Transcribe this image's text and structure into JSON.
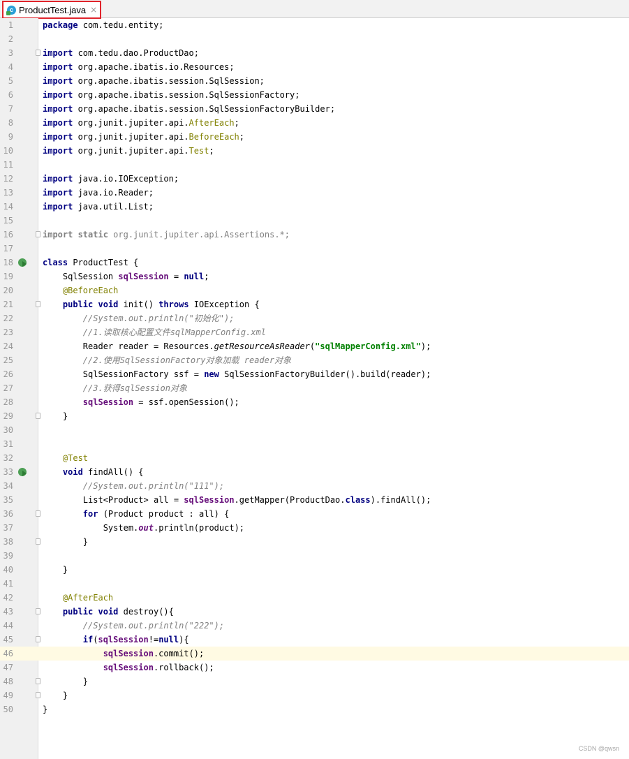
{
  "tab": {
    "label": "ProductTest.java",
    "close": "×",
    "icon": "java-class-icon",
    "icon_glyph": "c"
  },
  "code_lines": [
    [
      [
        "package",
        "kw"
      ],
      [
        " com.tedu.entity;",
        ""
      ]
    ],
    [],
    [
      [
        "import",
        "kw"
      ],
      [
        " com.tedu.dao.ProductDao;",
        ""
      ]
    ],
    [
      [
        "import",
        "kw"
      ],
      [
        " org.apache.ibatis.io.Resources;",
        ""
      ]
    ],
    [
      [
        "import",
        "kw"
      ],
      [
        " org.apache.ibatis.session.SqlSession;",
        ""
      ]
    ],
    [
      [
        "import",
        "kw"
      ],
      [
        " org.apache.ibatis.session.SqlSessionFactory;",
        ""
      ]
    ],
    [
      [
        "import",
        "kw"
      ],
      [
        " org.apache.ibatis.session.SqlSessionFactoryBuilder;",
        ""
      ]
    ],
    [
      [
        "import",
        "kw"
      ],
      [
        " org.junit.jupiter.api.",
        ""
      ],
      [
        "AfterEach",
        "an"
      ],
      [
        ";",
        ""
      ]
    ],
    [
      [
        "import",
        "kw"
      ],
      [
        " org.junit.jupiter.api.",
        ""
      ],
      [
        "BeforeEach",
        "an"
      ],
      [
        ";",
        ""
      ]
    ],
    [
      [
        "import",
        "kw"
      ],
      [
        " org.junit.jupiter.api.",
        ""
      ],
      [
        "Test",
        "an"
      ],
      [
        ";",
        ""
      ]
    ],
    [],
    [
      [
        "import",
        "kw"
      ],
      [
        " java.io.IOException;",
        ""
      ]
    ],
    [
      [
        "import",
        "kw"
      ],
      [
        " java.io.Reader;",
        ""
      ]
    ],
    [
      [
        "import",
        "kw"
      ],
      [
        " java.util.List;",
        ""
      ]
    ],
    [],
    [
      [
        "import static",
        "kw gry"
      ],
      [
        " org.junit.jupiter.api.Assertions.*;",
        "gry"
      ]
    ],
    [],
    [
      [
        "class",
        "kw"
      ],
      [
        " ProductTest {",
        ""
      ]
    ],
    [
      [
        "    SqlSession ",
        ""
      ],
      [
        "sqlSession",
        "fld"
      ],
      [
        " = ",
        ""
      ],
      [
        "null",
        "kw"
      ],
      [
        ";",
        ""
      ]
    ],
    [
      [
        "    ",
        ""
      ],
      [
        "@BeforeEach",
        "an"
      ]
    ],
    [
      [
        "    ",
        ""
      ],
      [
        "public",
        "kw"
      ],
      [
        " ",
        ""
      ],
      [
        "void",
        "kw"
      ],
      [
        " init() ",
        ""
      ],
      [
        "throws",
        "kw"
      ],
      [
        " IOException {",
        ""
      ]
    ],
    [
      [
        "        ",
        ""
      ],
      [
        "//System.out.println(\"初始化\");",
        "cm"
      ]
    ],
    [
      [
        "        ",
        ""
      ],
      [
        "//1.读取核心配置文件sqlMapperConfig.xml",
        "cm"
      ]
    ],
    [
      [
        "        Reader reader = Resources.",
        ""
      ],
      [
        "getResourceAsReader",
        "sta"
      ],
      [
        "(",
        ""
      ],
      [
        "\"sqlMapperConfig.xml\"",
        "str"
      ],
      [
        ");",
        ""
      ]
    ],
    [
      [
        "        ",
        ""
      ],
      [
        "//2.使用SqlSessionFactory对象加载 reader对象",
        "cm"
      ]
    ],
    [
      [
        "        SqlSessionFactory ssf = ",
        ""
      ],
      [
        "new",
        "kw"
      ],
      [
        " SqlSessionFactoryBuilder().build(reader);",
        ""
      ]
    ],
    [
      [
        "        ",
        ""
      ],
      [
        "//3.获得sqlSession对象",
        "cm"
      ]
    ],
    [
      [
        "        ",
        ""
      ],
      [
        "sqlSession",
        "fld"
      ],
      [
        " = ssf.openSession();",
        ""
      ]
    ],
    [
      [
        "    }",
        ""
      ]
    ],
    [],
    [],
    [
      [
        "    ",
        ""
      ],
      [
        "@Test",
        "an"
      ]
    ],
    [
      [
        "    ",
        ""
      ],
      [
        "void",
        "kw"
      ],
      [
        " findAll() {",
        ""
      ]
    ],
    [
      [
        "        ",
        ""
      ],
      [
        "//System.out.println(\"111\");",
        "cm"
      ]
    ],
    [
      [
        "        List<Product> all = ",
        ""
      ],
      [
        "sqlSession",
        "fld"
      ],
      [
        ".getMapper(ProductDao.",
        ""
      ],
      [
        "class",
        "kw"
      ],
      [
        ").findAll();",
        ""
      ]
    ],
    [
      [
        "        ",
        ""
      ],
      [
        "for",
        "kw"
      ],
      [
        " (Product product : all) {",
        ""
      ]
    ],
    [
      [
        "            System.",
        ""
      ],
      [
        "out",
        "stf"
      ],
      [
        ".println(product);",
        ""
      ]
    ],
    [
      [
        "        }",
        ""
      ]
    ],
    [],
    [
      [
        "    }",
        ""
      ]
    ],
    [],
    [
      [
        "    ",
        ""
      ],
      [
        "@AfterEach",
        "an"
      ]
    ],
    [
      [
        "    ",
        ""
      ],
      [
        "public",
        "kw"
      ],
      [
        " ",
        ""
      ],
      [
        "void",
        "kw"
      ],
      [
        " destroy(){",
        ""
      ]
    ],
    [
      [
        "        ",
        ""
      ],
      [
        "//System.out.println(\"222\");",
        "cm"
      ]
    ],
    [
      [
        "        ",
        ""
      ],
      [
        "if",
        "kw"
      ],
      [
        "(",
        ""
      ],
      [
        "sqlSession",
        "fld"
      ],
      [
        "!=",
        ""
      ],
      [
        "null",
        "kw"
      ],
      [
        "){",
        ""
      ]
    ],
    [
      [
        "            ",
        ""
      ],
      [
        "sqlSession",
        "fld"
      ],
      [
        ".commit();",
        ""
      ]
    ],
    [
      [
        "            ",
        ""
      ],
      [
        "sqlSession",
        "fld"
      ],
      [
        ".rollback();",
        ""
      ]
    ],
    [
      [
        "        }",
        ""
      ]
    ],
    [
      [
        "    }",
        ""
      ]
    ],
    [
      [
        "}",
        ""
      ]
    ]
  ],
  "run_markers": [
    18,
    33
  ],
  "fold_markers": [
    3,
    16,
    21,
    29,
    36,
    38,
    43,
    45,
    48,
    49
  ],
  "current_line": 46,
  "watermark": "CSDN @qwsn",
  "colors": {
    "keyword": "#000080",
    "annotation": "#808000",
    "field": "#660e7a",
    "comment": "#808080",
    "string": "#008000",
    "current_line_bg": "#fffae3",
    "tab_highlight_border": "#e0242c"
  }
}
